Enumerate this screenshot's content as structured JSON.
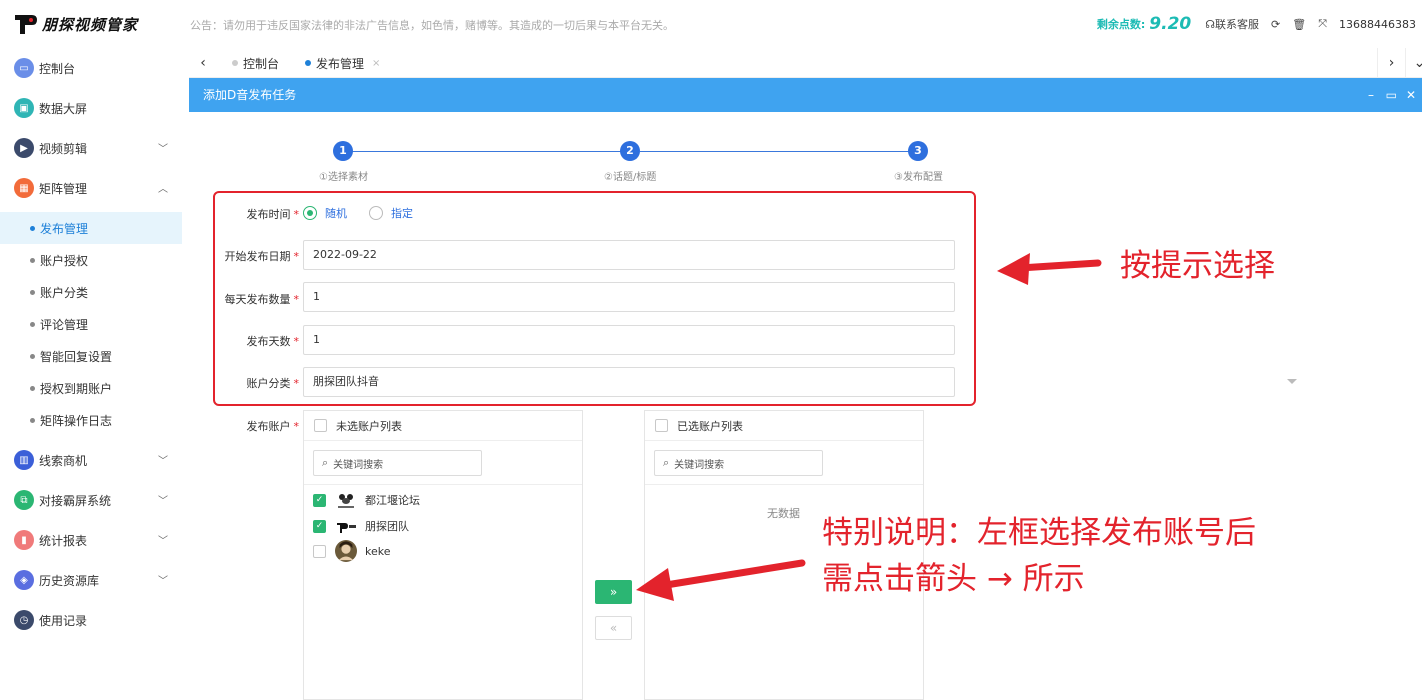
{
  "app": {
    "name": "朋探视频管家"
  },
  "notice": "公告：请勿用于违反国家法律的非法广告信息，如色情，赌博等。其造成的一切后果与本平台无关。",
  "topbar": {
    "points_label": "剩余点数:",
    "points_value": "9.20",
    "service_label": "联系客服",
    "user_phone": "13688446383"
  },
  "sidebar": {
    "items": [
      {
        "label": "控制台",
        "icon": "monitor-icon",
        "color": "#6a8ee8"
      },
      {
        "label": "数据大屏",
        "icon": "screen-icon",
        "color": "#2fb5b5"
      },
      {
        "label": "视频剪辑",
        "icon": "video-icon",
        "color": "#3b4a6b"
      },
      {
        "label": "矩阵管理",
        "icon": "grid-icon",
        "color": "#f26b3a"
      },
      {
        "label": "线索商机",
        "icon": "chart-icon",
        "color": "#3b5fd8"
      },
      {
        "label": "对接霸屏系统",
        "icon": "link-icon",
        "color": "#2bb673"
      },
      {
        "label": "统计报表",
        "icon": "bar-icon",
        "color": "#f07a7a"
      },
      {
        "label": "历史资源库",
        "icon": "layers-icon",
        "color": "#5a6ee0"
      },
      {
        "label": "使用记录",
        "icon": "clock-icon",
        "color": "#3b4a6b"
      }
    ],
    "sub_items": [
      "发布管理",
      "账户授权",
      "账户分类",
      "评论管理",
      "智能回复设置",
      "授权到期账户",
      "矩阵操作日志"
    ]
  },
  "tabs": [
    {
      "label": "控制台"
    },
    {
      "label": "发布管理"
    }
  ],
  "panel": {
    "title": "添加D音发布任务"
  },
  "steps": [
    {
      "num": "1",
      "label": "①选择素材"
    },
    {
      "num": "2",
      "label": "②话题/标题"
    },
    {
      "num": "3",
      "label": "③发布配置"
    }
  ],
  "form": {
    "publish_time_label": "发布时间",
    "radio_random": "随机",
    "radio_specified": "指定",
    "start_date_label": "开始发布日期",
    "start_date_value": "2022-09-22",
    "daily_count_label": "每天发布数量",
    "daily_count_value": "1",
    "days_label": "发布天数",
    "days_value": "1",
    "category_label": "账户分类",
    "category_value": "朋探团队抖音",
    "accounts_label": "发布账户"
  },
  "transfer": {
    "left_title": "未选账户列表",
    "right_title": "已选账户列表",
    "search_placeholder": "关键词搜索",
    "empty_text": "无数据",
    "left_accounts": [
      {
        "name": "都江堰论坛",
        "checked": true,
        "avatar_text": "都江堰"
      },
      {
        "name": "朋探团队",
        "checked": true,
        "avatar_text": "P朋探"
      },
      {
        "name": "keke",
        "checked": false,
        "avatar_text": ""
      }
    ]
  },
  "annotations": {
    "hint_top": "按提示选择",
    "hint_bottom_1": "特别说明：左框选择发布账号后",
    "hint_bottom_2": "需点击箭头 → 所示"
  },
  "colors": {
    "accent": "#3fa3f0",
    "step_blue": "#2e6fde",
    "green": "#2bb673",
    "annotation_red": "#e3232c",
    "points": "#1cbbb4"
  }
}
